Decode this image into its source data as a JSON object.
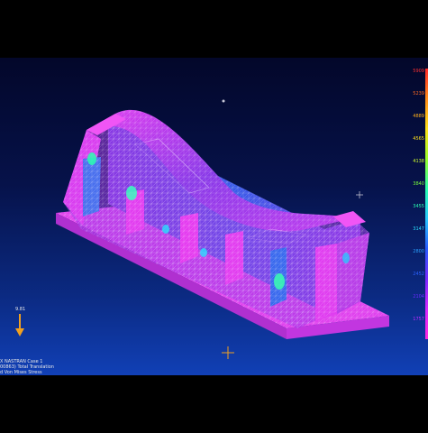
{
  "legend": {
    "title": "",
    "values": [
      "5909",
      "5239",
      "4889",
      "4565",
      "4138",
      "3840",
      "3455",
      "3147",
      "2800",
      "2452",
      "2104",
      "1757"
    ],
    "colors": [
      "#ff3030",
      "#ff6a20",
      "#ffb01a",
      "#ffe01a",
      "#d0ff2a",
      "#7aff3a",
      "#2affb0",
      "#2ae0ff",
      "#2aa0ff",
      "#2a60ff",
      "#6a2aff",
      "#c02aff"
    ]
  },
  "gravity": {
    "label": "9.81"
  },
  "info": {
    "line1": "X NASTRAN Case 1",
    "line2": "00863) Total Translation",
    "line3": "d Von Mises Stress"
  },
  "mesh": {
    "base_color": "#e53cf0",
    "mid_color": "#7a32e8",
    "low_color": "#2a64e8",
    "hot_color": "#2affb0"
  }
}
